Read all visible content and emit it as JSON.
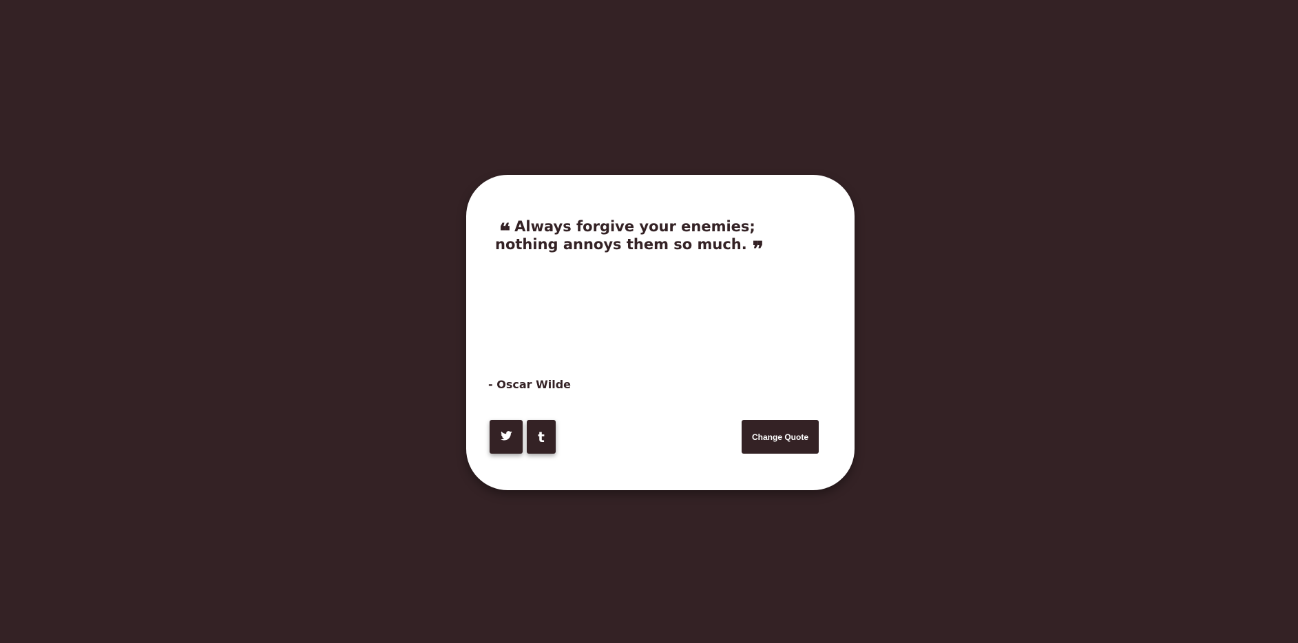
{
  "quote": {
    "text": "Always forgive your enemies; nothing annoys them so much.",
    "open_icon": "left-quote-icon",
    "close_icon": "right-quote-icon"
  },
  "author": {
    "text": "- Oscar Wilde"
  },
  "actions": {
    "twitter_icon": "twitter-icon",
    "tumblr_icon": "tumblr-icon",
    "change_label": "Change Quote"
  },
  "colors": {
    "background": "#342225",
    "card": "#ffffff",
    "text": "#342225",
    "button": "#342225",
    "button_text": "#ffffff"
  }
}
